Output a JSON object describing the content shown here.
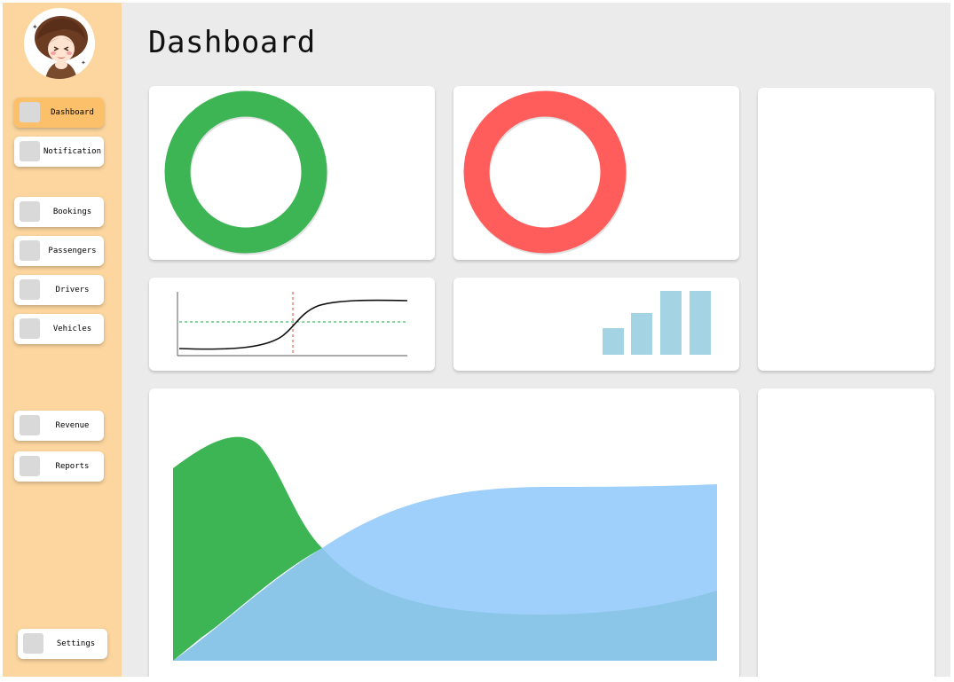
{
  "page": {
    "title": "Dashboard"
  },
  "sidebar": {
    "avatar": "avatar-illustration",
    "items": [
      {
        "label": "Dashboard",
        "icon": "dashboard-icon",
        "active": true
      },
      {
        "label": "Notification",
        "icon": "notification-icon"
      },
      {
        "label": "Bookings",
        "icon": "bookings-icon"
      },
      {
        "label": "Passengers",
        "icon": "passengers-icon"
      },
      {
        "label": "Drivers",
        "icon": "drivers-icon"
      },
      {
        "label": "Vehicles",
        "icon": "vehicles-icon"
      },
      {
        "label": "Revenue",
        "icon": "revenue-icon"
      },
      {
        "label": "Reports",
        "icon": "reports-icon"
      },
      {
        "label": "Settings",
        "icon": "settings-icon"
      }
    ]
  },
  "colors": {
    "sidebar": "#fcd69e",
    "active_item": "#fcc06a",
    "ring_green": "#3db554",
    "ring_red": "#ff5c5c",
    "bars": "#a4d4e4",
    "area_green": "#3db554",
    "area_blue": "#9ed0fb",
    "area_overlap": "#8bc5e8",
    "guide_h": "#2aa34a",
    "guide_v": "#e8593f"
  }
}
